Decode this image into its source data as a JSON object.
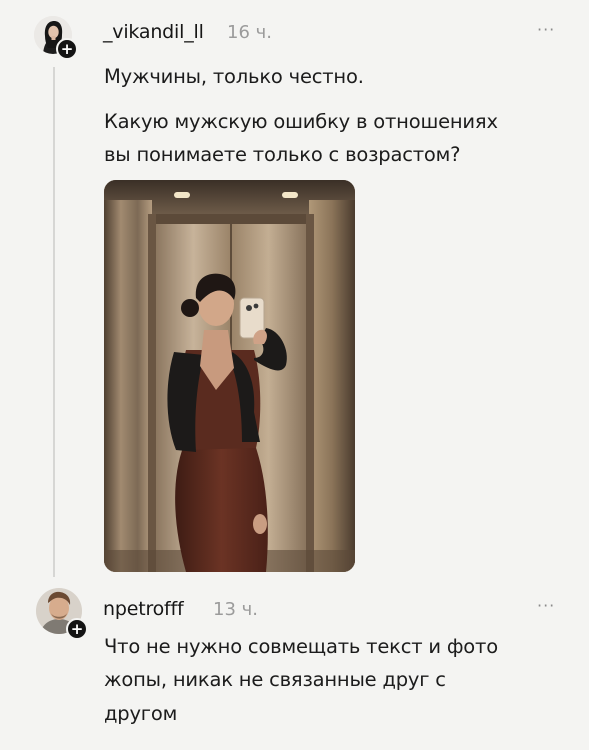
{
  "post": {
    "username": "_vikandil_ll",
    "time": "16 ч.",
    "more": "···",
    "text_line1": "Мужчины, только честно.",
    "text_line2": "Какую мужскую ошибку в отношениях",
    "text_line3": "вы понимаете только с возрастом?",
    "avatar_icon": "user-avatar-woman",
    "badge": "+"
  },
  "reply": {
    "username": "npetrofff",
    "time": "13 ч.",
    "more": "···",
    "text_line1": "Что не нужно совмещать текст и фото",
    "text_line2": "жопы, никак не связанные друг с",
    "text_line3": "другом",
    "avatar_icon": "user-avatar-man",
    "badge": "+"
  },
  "colors": {
    "background": "#f4f4f2",
    "text": "#1c1c1c",
    "muted": "#9b9b9b",
    "thread_line": "#d6d6d4"
  }
}
